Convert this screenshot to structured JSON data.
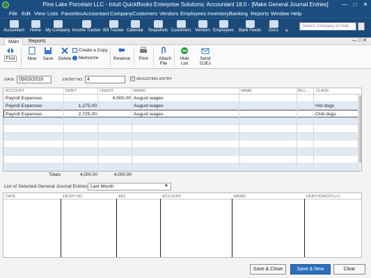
{
  "window": {
    "title": "Pine Lake Porcelain LLC  - Intuit QuickBooks Enterprise Solutions: Accountant 18.0 - [Make General Journal Entries]",
    "controls": [
      "—",
      "□",
      "✕"
    ]
  },
  "menu": [
    "File",
    "Edit",
    "View",
    "Lists",
    "Favorites",
    "Accountant",
    "Company",
    "Customers",
    "Vendors",
    "Employees",
    "Inventory",
    "Banking",
    "Reports",
    "Window",
    "Help"
  ],
  "iconbar": {
    "items": [
      {
        "label": "Accountant",
        "icon": "accountant-icon"
      },
      {
        "label": "Home",
        "icon": "home-icon"
      },
      {
        "label": "My Company",
        "icon": "company-icon"
      },
      {
        "label": "Income Tracker",
        "icon": "income-tracker-icon"
      },
      {
        "label": "Bill Tracker",
        "icon": "bill-tracker-icon"
      },
      {
        "label": "Calendar",
        "icon": "calendar-icon"
      },
      {
        "label": "Snapshots",
        "icon": "snapshots-icon"
      },
      {
        "label": "Customers",
        "icon": "customers-icon"
      },
      {
        "label": "Vendors",
        "icon": "vendors-icon"
      },
      {
        "label": "Employees",
        "icon": "employees-icon"
      },
      {
        "label": "Bank Feeds",
        "icon": "bank-feeds-icon"
      },
      {
        "label": "Docs",
        "icon": "docs-icon"
      }
    ],
    "more": "»",
    "search_placeholder": "Search Company or Help"
  },
  "ribbon": {
    "tabs": [
      "Main",
      "Reports"
    ],
    "active_tab": "Main",
    "window_controls": "—  □  ✕"
  },
  "toolbar": {
    "find": "Find",
    "new": "New",
    "save": "Save",
    "delete": "Delete",
    "create_copy": "Create a Copy",
    "memorize": "Memorize",
    "reverse": "Reverse",
    "print": "Print",
    "attach_file": "Attach File",
    "hide_list": "Hide List",
    "send_gjes": "Send GJEs"
  },
  "entry": {
    "date_label": "DATE",
    "date_value": "09/03/2018",
    "entry_no_label": "ENTRY NO.",
    "entry_no_value": "4",
    "adjusting_label": "ADJUSTING ENTRY",
    "adjusting_checked": true
  },
  "grid": {
    "columns": [
      "ACCOUNT",
      "DEBIT",
      "CREDIT",
      "MEMO",
      "NAME",
      "BILL...",
      "CLASS"
    ],
    "rows": [
      {
        "account": "Payroll Expenses",
        "debit": "",
        "credit": "4,000.00",
        "memo": "August wages",
        "name": "",
        "billable": "",
        "class": ""
      },
      {
        "account": "Payroll Expenses",
        "debit": "1,275.00",
        "credit": "",
        "memo": "August wages",
        "name": "",
        "billable": "",
        "class": "Hot dogs"
      },
      {
        "account": "Payroll Expenses",
        "debit": "2,725.00",
        "credit": "",
        "memo": "August wages",
        "name": "",
        "billable": "",
        "class": "Chili dogs"
      }
    ],
    "totals_label": "Totals",
    "total_debit": "4,000.00",
    "total_credit": "4,000.00"
  },
  "list": {
    "label": "List of Selected General Journal Entries:",
    "period": "Last Month",
    "columns": [
      "DATE",
      "ENTRY NO.",
      "ADJ",
      "ACCOUNT",
      "MEMO",
      "DEBIT/CREDIT(+/-)"
    ]
  },
  "buttons": {
    "save_close": "Save & Close",
    "save_new": "Save & New",
    "clear": "Clear"
  },
  "colors": {
    "titlebar": "#1b4d80",
    "iconbar": "#1c4a78",
    "row_alt": "#dfeaf6",
    "primary_button": "#2d6fbd"
  }
}
